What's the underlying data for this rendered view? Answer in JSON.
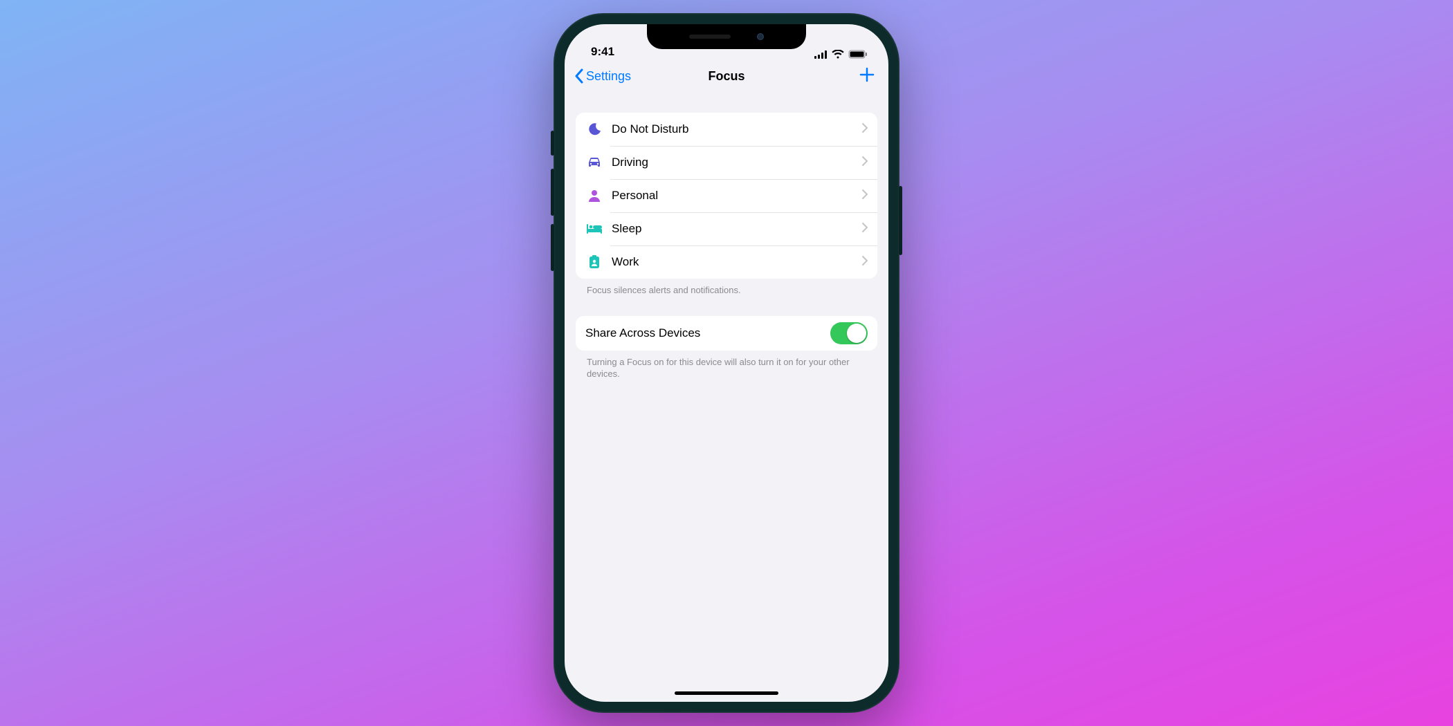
{
  "statusbar": {
    "time": "9:41"
  },
  "navbar": {
    "back": "Settings",
    "title": "Focus"
  },
  "focus_modes": [
    {
      "label": "Do Not Disturb",
      "icon": "moon",
      "color": "#5856d6"
    },
    {
      "label": "Driving",
      "icon": "car",
      "color": "#5856d6"
    },
    {
      "label": "Personal",
      "icon": "person",
      "color": "#af52de"
    },
    {
      "label": "Sleep",
      "icon": "bed",
      "color": "#1fc4b9"
    },
    {
      "label": "Work",
      "icon": "badge",
      "color": "#1fc4b9"
    }
  ],
  "focus_footer": "Focus silences alerts and notifications.",
  "share": {
    "label": "Share Across Devices",
    "enabled": true,
    "footer": "Turning a Focus on for this device will also turn it on for your other devices."
  }
}
